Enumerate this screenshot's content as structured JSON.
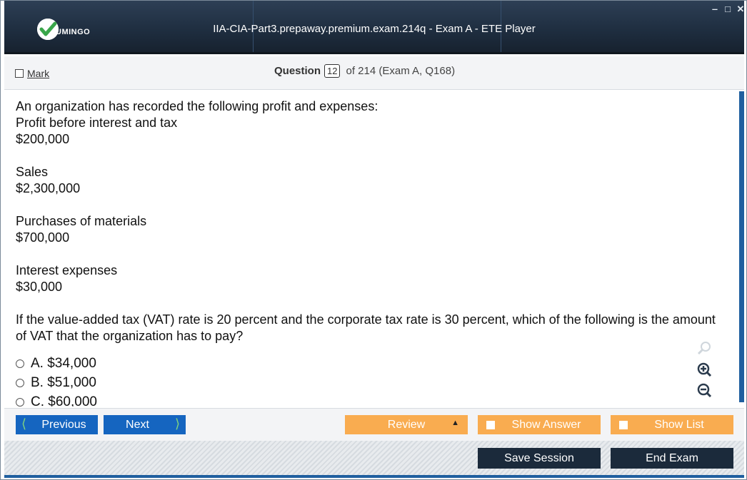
{
  "window": {
    "title": "IIA-CIA-Part3.prepaway.premium.exam.214q - Exam A - ETE Player",
    "logo_text": "UMINGO",
    "controls": [
      "minimize",
      "maximize",
      "close"
    ]
  },
  "header": {
    "mark_label": "Mark",
    "question_label": "Question",
    "question_number": "12",
    "question_of": "of 214 (Exam A, Q168)"
  },
  "question": {
    "lines": [
      "An organization has recorded the following profit and expenses:",
      "Profit before interest and tax",
      "$200,000",
      "Sales",
      "$2,300,000",
      "Purchases of materials",
      "$700,000",
      "Interest expenses",
      "$30,000",
      "If the value-added tax (VAT) rate is 20 percent and the corporate tax rate is 30 percent, which of the following is the amount of VAT that the organization has to pay?"
    ],
    "options": [
      "A. $34,000",
      "B. $51,000",
      "C. $60,000"
    ]
  },
  "icons": {
    "search": "search-icon",
    "zoom_in": "zoom-in-icon",
    "zoom_out": "zoom-out-icon"
  },
  "nav": {
    "previous": "Previous",
    "next": "Next",
    "review": "Review",
    "show_answer": "Show Answer",
    "show_list": "Show List",
    "save_session": "Save Session",
    "end_exam": "End Exam"
  },
  "colors": {
    "accent_blue": "#1565c0",
    "orange": "#f9ac50",
    "dark": "#1b2a3b"
  }
}
